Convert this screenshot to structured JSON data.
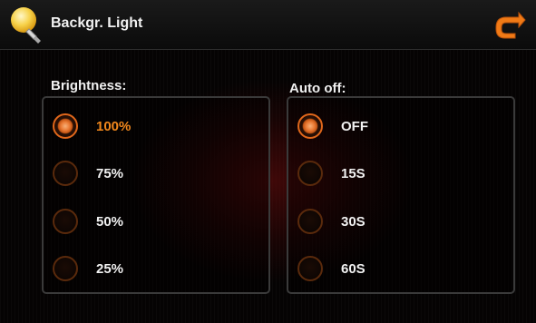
{
  "header": {
    "title": "Backgr. Light",
    "left_icon": "bulb-icon",
    "right_icon": "back-arrow-icon"
  },
  "brightness": {
    "label": "Brightness:",
    "options": [
      "100%",
      "75%",
      "50%",
      "25%"
    ],
    "selected": "100%"
  },
  "auto_off": {
    "label": "Auto off:",
    "options": [
      "OFF",
      "15S",
      "30S",
      "60S"
    ],
    "selected": "OFF"
  },
  "colors": {
    "accent": "#f2881c",
    "background": "#050303",
    "panel_border": "#3a3a3a"
  }
}
